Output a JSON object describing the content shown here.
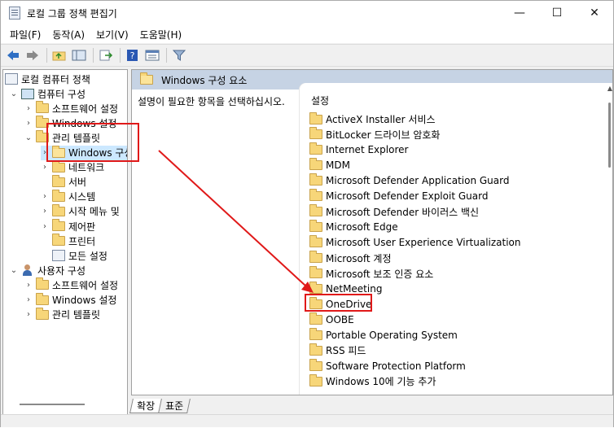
{
  "window": {
    "title": "로컬 그룹 정책 편집기",
    "controls": [
      "—",
      "☐",
      "✕"
    ]
  },
  "menu": [
    "파일(F)",
    "동작(A)",
    "보기(V)",
    "도움말(H)"
  ],
  "toolbar": {
    "buttons": [
      "back-arrow-icon",
      "forward-arrow-icon",
      "up-folder-icon",
      "show-tree-icon",
      "export-icon",
      "help-icon",
      "properties-icon",
      "filter-icon"
    ]
  },
  "tree": {
    "items": [
      {
        "label": "로컬 컴퓨터 정책",
        "level": 0,
        "icon": "doc",
        "expand": ""
      },
      {
        "label": "컴퓨터 구성",
        "level": 1,
        "icon": "pc",
        "expand": "⌄"
      },
      {
        "label": "소프트웨어 설정",
        "level": 2,
        "icon": "folder",
        "expand": "›"
      },
      {
        "label": "Windows 설정",
        "level": 2,
        "icon": "folder",
        "expand": "›"
      },
      {
        "label": "관리 템플릿",
        "level": 2,
        "icon": "folder",
        "expand": "⌄"
      },
      {
        "label": "Windows 구성",
        "level": 3,
        "icon": "folder-open",
        "expand": "›"
      },
      {
        "label": "네트워크",
        "level": 3,
        "icon": "folder",
        "expand": "›"
      },
      {
        "label": "서버",
        "level": 3,
        "icon": "folder",
        "expand": ""
      },
      {
        "label": "시스템",
        "level": 3,
        "icon": "folder",
        "expand": "›"
      },
      {
        "label": "시작 메뉴 및",
        "level": 3,
        "icon": "folder",
        "expand": "›"
      },
      {
        "label": "제어판",
        "level": 3,
        "icon": "folder",
        "expand": "›"
      },
      {
        "label": "프린터",
        "level": 3,
        "icon": "folder",
        "expand": ""
      },
      {
        "label": "모든 설정",
        "level": 3,
        "icon": "doc",
        "expand": ""
      },
      {
        "label": "사용자 구성",
        "level": 1,
        "icon": "user",
        "expand": "⌄"
      },
      {
        "label": "소프트웨어 설정",
        "level": 2,
        "icon": "folder",
        "expand": "›"
      },
      {
        "label": "Windows 설정",
        "level": 2,
        "icon": "folder",
        "expand": "›"
      },
      {
        "label": "관리 템플릿",
        "level": 2,
        "icon": "folder",
        "expand": "›"
      }
    ]
  },
  "right": {
    "header": "Windows 구성 요소",
    "description": "설명이 필요한 항목을 선택하십시오.",
    "list_header": "설정",
    "items": [
      "ActiveX Installer 서비스",
      "BitLocker 드라이브 암호화",
      "Internet Explorer",
      "MDM",
      "Microsoft Defender Application Guard",
      "Microsoft Defender Exploit Guard",
      "Microsoft Defender 바이러스 백신",
      "Microsoft Edge",
      "Microsoft User Experience Virtualization",
      "Microsoft 계정",
      "Microsoft 보조 인증 요소",
      "NetMeeting",
      "OneDrive",
      "OOBE",
      "Portable Operating System",
      "RSS 피드",
      "Software Protection Platform",
      "Windows 10에 기능 추가"
    ]
  },
  "tabs": [
    "확장",
    "표준"
  ],
  "colors": {
    "annotation": "#e01919",
    "header_bg": "#c6d3e4",
    "folder": "#f7d679"
  }
}
